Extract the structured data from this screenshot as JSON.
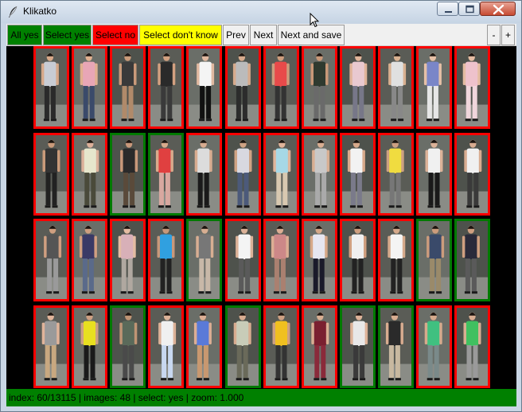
{
  "window": {
    "title": "Klikatko",
    "icon": "feather-icon",
    "controls": [
      "minimize-icon",
      "maximize-icon",
      "close-icon"
    ]
  },
  "toolbar": {
    "all_yes": "All yes",
    "select_yes": "Select yes",
    "select_no": "Select no",
    "select_dont_know": "Select don't know",
    "prev": "Prev",
    "next": "Next",
    "next_and_save": "Next and save",
    "zoom_out": "-",
    "zoom_in": "+"
  },
  "colors": {
    "yes": "#008000",
    "no": "#ff0000",
    "dont_know": "#ffff00",
    "background": "#000000"
  },
  "grid": {
    "rows": [
      [
        "no",
        "no",
        "no",
        "no",
        "no",
        "no",
        "no",
        "no",
        "no",
        "no",
        "no",
        "no"
      ],
      [
        "no",
        "no",
        "yes",
        "yes",
        "no",
        "no",
        "no",
        "no",
        "no",
        "no",
        "no",
        "no"
      ],
      [
        "no",
        "no",
        "no",
        "no",
        "yes",
        "no",
        "no",
        "no",
        "no",
        "no",
        "yes",
        "yes"
      ],
      [
        "no",
        "no",
        "yes",
        "no",
        "no",
        "yes",
        "no",
        "no",
        "yes",
        "yes",
        "no",
        "no"
      ]
    ],
    "items": [
      {
        "top": "#c8ccd4",
        "bottom": "#2a2a2a",
        "skin": "#d6a889"
      },
      {
        "top": "#e8a6b6",
        "bottom": "#3a4a6a",
        "skin": "#e0b090"
      },
      {
        "top": "#3a3a3a",
        "bottom": "#b08a6a",
        "skin": "#c99a7a"
      },
      {
        "top": "#2a2a2a",
        "bottom": "#3a3a3a",
        "skin": "#d2a080"
      },
      {
        "top": "#f4f4f4",
        "bottom": "#111111",
        "skin": "#e0b8a0"
      },
      {
        "top": "#bbbbbb",
        "bottom": "#2c2c2c",
        "skin": "#d6aa8c"
      },
      {
        "top": "#e84a4a",
        "bottom": "#333333",
        "skin": "#cc9c7c"
      },
      {
        "top": "#2f3a2f",
        "bottom": "#6a6a6a",
        "skin": "#c89878"
      },
      {
        "top": "#e9c9d0",
        "bottom": "#777788",
        "skin": "#e0b49a"
      },
      {
        "top": "#e0e0e0",
        "bottom": "#888888",
        "skin": "#d8b090"
      },
      {
        "top": "#7a86c8",
        "bottom": "#e6e6e6",
        "skin": "#e6c0a6"
      },
      {
        "top": "#eec2cc",
        "bottom": "#f0d6dc",
        "skin": "#e4bca2"
      },
      {
        "top": "#333333",
        "bottom": "#222222",
        "skin": "#c99a7a"
      },
      {
        "top": "#e6e6cc",
        "bottom": "#4a4a3a",
        "skin": "#dcb09a"
      },
      {
        "top": "#2a2a2a",
        "bottom": "#5a4a3a",
        "skin": "#c8987a"
      },
      {
        "top": "#e04040",
        "bottom": "#d8a8a0",
        "skin": "#d8aa8c"
      },
      {
        "top": "#dcdcdc",
        "bottom": "#1a1a1a",
        "skin": "#d8ac90"
      },
      {
        "top": "#d8d8e0",
        "bottom": "#4c5a7a",
        "skin": "#cfa384"
      },
      {
        "top": "#a6d8e6",
        "bottom": "#d8c8b0",
        "skin": "#e0b49a"
      },
      {
        "top": "#c8c8c8",
        "bottom": "#aaaaaa",
        "skin": "#d8ae92"
      },
      {
        "top": "#f2f2f2",
        "bottom": "#7a7a8a",
        "skin": "#d8aa8c"
      },
      {
        "top": "#f0dc40",
        "bottom": "#777777",
        "skin": "#cda082"
      },
      {
        "top": "#f0f0f0",
        "bottom": "#1a1a1a",
        "skin": "#dcb298"
      },
      {
        "top": "#f0f0f0",
        "bottom": "#3a3a3a",
        "skin": "#d8ac90"
      },
      {
        "top": "#555555",
        "bottom": "#9a9a9a",
        "skin": "#cf9f80"
      },
      {
        "top": "#3a3a66",
        "bottom": "#5a6a8a",
        "skin": "#cf9f80"
      },
      {
        "top": "#d8b0b8",
        "bottom": "#b0a8a0",
        "skin": "#e4bca2"
      },
      {
        "top": "#30a0e0",
        "bottom": "#222222",
        "skin": "#c8987a"
      },
      {
        "top": "#777777",
        "bottom": "#c8b8a8",
        "skin": "#d8ae92"
      },
      {
        "top": "#f4f4f4",
        "bottom": "#5a5a5a",
        "skin": "#dcb298"
      },
      {
        "top": "#cc8888",
        "bottom": "#aa8070",
        "skin": "#dcae94"
      },
      {
        "top": "#e6e6f0",
        "bottom": "#1a1a2a",
        "skin": "#d6a888"
      },
      {
        "top": "#f0f0f0",
        "bottom": "#222222",
        "skin": "#d0a080"
      },
      {
        "top": "#f4f4f4",
        "bottom": "#222222",
        "skin": "#d6aa8c"
      },
      {
        "top": "#3a4a6a",
        "bottom": "#9a8a6a",
        "skin": "#cc9c7c"
      },
      {
        "top": "#2a2a3a",
        "bottom": "#5a5a5a",
        "skin": "#cf9f80"
      },
      {
        "top": "#9a9a9a",
        "bottom": "#c8a880",
        "skin": "#e0b49a"
      },
      {
        "top": "#e8e020",
        "bottom": "#1a1a1a",
        "skin": "#cda082"
      },
      {
        "top": "#5a6a5a",
        "bottom": "#4a4a4a",
        "skin": "#bf9474"
      },
      {
        "top": "#f0f0f0",
        "bottom": "#c8d8f0",
        "skin": "#dcb298"
      },
      {
        "top": "#5a7ad8",
        "bottom": "#c89870",
        "skin": "#dcae94"
      },
      {
        "top": "#c8ccb8",
        "bottom": "#6a6a5a",
        "skin": "#d8ac90"
      },
      {
        "top": "#f0c020",
        "bottom": "#333333",
        "skin": "#cda082"
      },
      {
        "top": "#7a2030",
        "bottom": "#8a2a3a",
        "skin": "#d8ae92"
      },
      {
        "top": "#e8e8e8",
        "bottom": "#3a3a3a",
        "skin": "#dcb298"
      },
      {
        "top": "#2a2a2a",
        "bottom": "#c8b8a0",
        "skin": "#d8ac90"
      },
      {
        "top": "#40c080",
        "bottom": "#7a8a8a",
        "skin": "#d6aa8c"
      },
      {
        "top": "#40c060",
        "bottom": "#9a9a9a",
        "skin": "#d8ae92"
      }
    ]
  },
  "status": {
    "text": "index: 60/13115 | images: 48 | select: yes | zoom: 1.000"
  }
}
